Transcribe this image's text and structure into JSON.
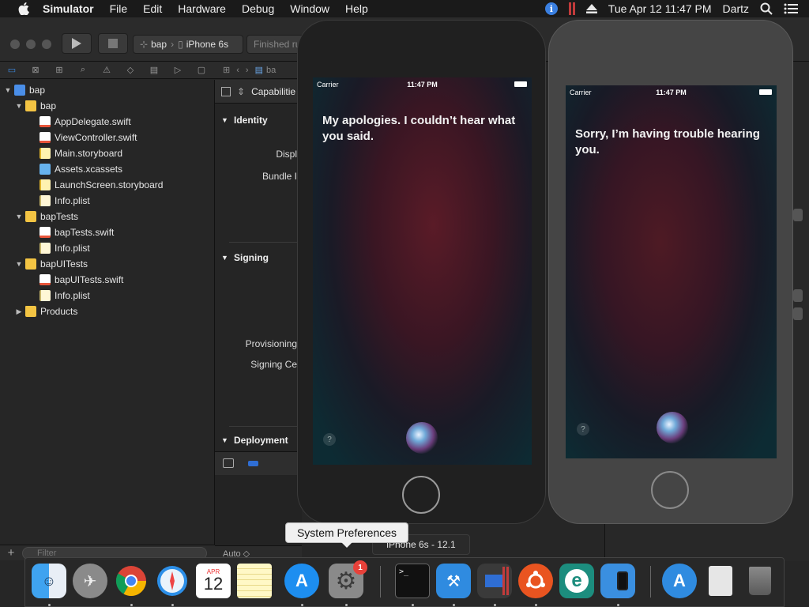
{
  "menubar": {
    "app": "Simulator",
    "menus": [
      "File",
      "Edit",
      "Hardware",
      "Debug",
      "Window",
      "Help"
    ],
    "datetime": "Tue Apr 12  11:47 PM",
    "user": "Dartz"
  },
  "toolbar": {
    "scheme": "bap",
    "device": "iPhone 6s",
    "status": "Finished ru"
  },
  "editor": {
    "jump_item": "ba",
    "tab": "Capabilitie",
    "sections": {
      "identity": "Identity",
      "signing": "Signing",
      "deployment": "Deployment"
    },
    "labels": {
      "display": "Displ",
      "bundle": "Bundle I",
      "provisioning": "Provisioning",
      "signing_cert": "Signing Ce"
    },
    "bar_auto": "Auto ◇"
  },
  "navigator": {
    "filter_placeholder": "Filter",
    "tree": [
      {
        "label": "bap",
        "type": "proj",
        "depth": 0,
        "disc": "▼"
      },
      {
        "label": "bap",
        "type": "folder",
        "depth": 1,
        "disc": "▼"
      },
      {
        "label": "AppDelegate.swift",
        "type": "swift",
        "depth": 2,
        "disc": ""
      },
      {
        "label": "ViewController.swift",
        "type": "swift",
        "depth": 2,
        "disc": ""
      },
      {
        "label": "Main.storyboard",
        "type": "sb",
        "depth": 2,
        "disc": ""
      },
      {
        "label": "Assets.xcassets",
        "type": "xca",
        "depth": 2,
        "disc": ""
      },
      {
        "label": "LaunchScreen.storyboard",
        "type": "sb",
        "depth": 2,
        "disc": ""
      },
      {
        "label": "Info.plist",
        "type": "plist",
        "depth": 2,
        "disc": ""
      },
      {
        "label": "bapTests",
        "type": "folder",
        "depth": 1,
        "disc": "▼"
      },
      {
        "label": "bapTests.swift",
        "type": "swift",
        "depth": 2,
        "disc": ""
      },
      {
        "label": "Info.plist",
        "type": "plist",
        "depth": 2,
        "disc": ""
      },
      {
        "label": "bapUITests",
        "type": "folder",
        "depth": 1,
        "disc": "▼"
      },
      {
        "label": "bapUITests.swift",
        "type": "swift",
        "depth": 2,
        "disc": ""
      },
      {
        "label": "Info.plist",
        "type": "plist",
        "depth": 2,
        "disc": ""
      },
      {
        "label": "Products",
        "type": "folder",
        "depth": 1,
        "disc": "▶"
      }
    ]
  },
  "phone1": {
    "carrier": "Carrier",
    "time": "11:47 PM",
    "message": "My apologies. I couldn’t hear what you said.",
    "help": "?"
  },
  "phone2": {
    "carrier": "Carrier",
    "time": "11:47 PM",
    "message": "Sorry, I’m having trouble hearing you.",
    "help": "?"
  },
  "simulator_name": "iPhone 6s - 12.1",
  "tooltip": "System Preferences",
  "dock": {
    "calendar_month": "APR",
    "calendar_day": "12",
    "prefs_badge": "1",
    "terminal_prompt": ">_",
    "eclipse_letter": "e"
  }
}
